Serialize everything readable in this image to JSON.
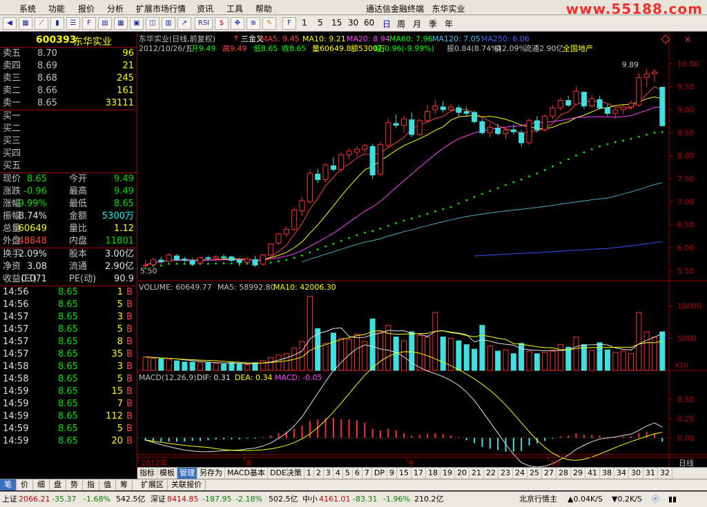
{
  "menu": [
    "系统",
    "功能",
    "报价",
    "分析",
    "扩展市场行情",
    "资讯",
    "工具",
    "帮助"
  ],
  "app_title": "通达信金融终端",
  "stock_title": "东华实业",
  "watermark": "www.55188.com",
  "toolbar": {
    "rsi": "RSI",
    "periods": [
      "1",
      "5",
      "15",
      "30",
      "60",
      "日",
      "周",
      "月",
      "季",
      "年"
    ]
  },
  "quote": {
    "code": "600393",
    "name": "东华实业",
    "asks": [
      [
        "卖五",
        "8.70",
        "96"
      ],
      [
        "卖四",
        "8.69",
        "21"
      ],
      [
        "卖三",
        "8.68",
        "245"
      ],
      [
        "卖二",
        "8.66",
        "161"
      ],
      [
        "卖一",
        "8.65",
        "33111"
      ]
    ],
    "bids": [
      "买一",
      "买二",
      "买三",
      "买四",
      "买五"
    ],
    "stats": [
      [
        "现价",
        "8.65",
        "今开",
        "9.49"
      ],
      [
        "涨跌",
        "-0.96",
        "最高",
        "9.49"
      ],
      [
        "涨幅",
        "-9.99%",
        "最低",
        "8.65"
      ],
      [
        "振幅",
        "8.74%",
        "金额",
        "5300万"
      ],
      [
        "总量",
        "60649",
        "量比",
        "1.12"
      ],
      [
        "外盘",
        "48848",
        "内盘",
        "11801"
      ]
    ],
    "stats2": [
      [
        "换手",
        "2.09%",
        "股本",
        "3.00亿"
      ],
      [
        "净资",
        "3.08",
        "流通",
        "2.90亿"
      ],
      [
        "收益(三)",
        "0.071",
        "PE(动)",
        "90.9"
      ]
    ]
  },
  "ticks": [
    [
      "14:56",
      "8.65",
      "1",
      "B"
    ],
    [
      "14:56",
      "8.65",
      "5",
      "B"
    ],
    [
      "14:57",
      "8.65",
      "3",
      "B"
    ],
    [
      "14:57",
      "8.65",
      "5",
      "B"
    ],
    [
      "14:57",
      "8.65",
      "8",
      "B"
    ],
    [
      "14:57",
      "8.65",
      "35",
      "B"
    ],
    [
      "14:58",
      "8.65",
      "3",
      "B"
    ],
    [
      "14:58",
      "8.65",
      "5",
      "B"
    ],
    [
      "14:59",
      "8.65",
      "15",
      "B"
    ],
    [
      "14:59",
      "8.65",
      "7",
      "B"
    ],
    [
      "14:59",
      "8.65",
      "112",
      "B"
    ],
    [
      "14:59",
      "8.65",
      "5",
      "B"
    ],
    [
      "14:59",
      "8.65",
      "20",
      "B"
    ]
  ],
  "left_tabs": [
    "笔",
    "价",
    "细",
    "盘",
    "势",
    "指",
    "值",
    "筹"
  ],
  "chart": {
    "header1": {
      "title": "东华实业(日线,前复权)",
      "signal": "三金叉",
      "ma5": "MA5: 9.45",
      "ma10": "MA10: 9.21",
      "ma20": "MA20: 8.94",
      "ma60": "MA60: 7.96",
      "ma120": "MA120: 7.05",
      "ma250": "MA250: 6.06"
    },
    "header2": {
      "date": "2012/10/26/五",
      "open": "开9.49",
      "high": "高9.49",
      "low": "低8.65",
      "close": "收8.65",
      "vol": "量60649.8",
      "amt": "额5300万",
      "chg": "幅-0.96(-9.99%)",
      "amp": "振0.84(8.74%)",
      "turn": "换2.09%",
      "float": "流通2.90亿",
      "sector": "全国地产"
    },
    "high_label": "9.89",
    "low_label": "5.50",
    "price_ticks": [
      "10.00",
      "9.50",
      "9.00",
      "8.50",
      "8.00",
      "7.50",
      "7.00",
      "6.50",
      "6.00",
      "5.50"
    ],
    "vol_header": {
      "title": "VOLUME: 60649.77",
      "ma5": "MA5: 58992.80",
      "ma10": "MA10: 42006.30"
    },
    "vol_ticks": [
      "10000",
      "5000"
    ],
    "vol_unit": "X10",
    "macd_header": {
      "title": "MACD(12,26,9)",
      "dif": "DIF: 0.31",
      "dea": "DEA: 0.34",
      "macd": "MACD: -0.05"
    },
    "macd_ticks": [
      "0.50",
      "0.25",
      "0.00"
    ],
    "date_labels": [
      "2012年",
      "8",
      "9",
      "10"
    ],
    "period_label": "日线"
  },
  "bottom_tabs": [
    "指标",
    "模板",
    "管理",
    "另存为",
    "MACD基本",
    "DDE决策",
    "1",
    "2",
    "3",
    "4",
    "5",
    "6",
    "7",
    "DP",
    "9",
    "15",
    "17",
    "18",
    "19",
    "20",
    "21",
    "22",
    "23",
    "24",
    "25",
    "27",
    "28",
    "29",
    "41",
    "38",
    "34",
    "30",
    "31",
    "32"
  ],
  "ext_tabs": [
    "扩展区",
    "关联报价"
  ],
  "status": {
    "sh_label": "上证",
    "sh_val": "2066.21",
    "sh_chg": "-35.37",
    "sh_pct": "-1.68%",
    "sh_amt": "542.5亿",
    "sz_label": "深证",
    "sz_val": "8414.85",
    "sz_chg": "-187.95",
    "sz_pct": "-2.18%",
    "sz_amt": "502.5亿",
    "zx_label": "中小",
    "zx_val": "4161.01",
    "zx_chg": "-83.31",
    "zx_pct": "-1.96%",
    "zx_amt": "210.2亿",
    "server": "北京行情主",
    "up": "0.04K/S",
    "down": "0.2K/S"
  },
  "chart_data": {
    "type": "candlestick",
    "title": "东华实业(日线,前复权)",
    "price_range": [
      5.4,
      10.2
    ],
    "candles": [
      [
        5.6,
        5.72,
        5.55,
        5.62
      ],
      [
        5.63,
        5.78,
        5.6,
        5.74
      ],
      [
        5.73,
        5.8,
        5.66,
        5.7
      ],
      [
        5.7,
        5.88,
        5.68,
        5.84
      ],
      [
        5.82,
        5.86,
        5.7,
        5.74
      ],
      [
        5.75,
        5.8,
        5.68,
        5.72
      ],
      [
        5.72,
        5.78,
        5.6,
        5.64
      ],
      [
        5.66,
        5.8,
        5.62,
        5.78
      ],
      [
        5.78,
        5.82,
        5.72,
        5.76
      ],
      [
        5.76,
        5.84,
        5.7,
        5.8
      ],
      [
        5.8,
        5.86,
        5.74,
        5.78
      ],
      [
        5.8,
        5.82,
        5.7,
        5.72
      ],
      [
        5.72,
        5.78,
        5.6,
        5.68
      ],
      [
        5.68,
        5.8,
        5.62,
        5.76
      ],
      [
        5.74,
        5.82,
        5.58,
        5.62
      ],
      [
        5.64,
        5.86,
        5.6,
        5.84
      ],
      [
        5.84,
        6.1,
        5.82,
        6.08
      ],
      [
        6.1,
        6.32,
        6.06,
        6.3
      ],
      [
        6.3,
        6.46,
        6.24,
        6.4
      ],
      [
        6.4,
        6.88,
        6.36,
        6.82
      ],
      [
        6.8,
        7.1,
        6.7,
        7.02
      ],
      [
        7.0,
        7.7,
        6.96,
        7.62
      ],
      [
        7.6,
        7.72,
        7.4,
        7.48
      ],
      [
        7.48,
        7.84,
        7.42,
        7.8
      ],
      [
        7.78,
        7.96,
        7.66,
        7.7
      ],
      [
        7.7,
        8.08,
        7.64,
        8.02
      ],
      [
        8.02,
        8.16,
        7.92,
        8.1
      ],
      [
        8.08,
        8.2,
        7.98,
        8.14
      ],
      [
        8.14,
        8.26,
        8.06,
        8.22
      ],
      [
        8.2,
        8.26,
        7.5,
        7.58
      ],
      [
        7.6,
        8.3,
        7.56,
        8.24
      ],
      [
        8.22,
        8.8,
        8.16,
        8.72
      ],
      [
        8.7,
        8.9,
        8.6,
        8.66
      ],
      [
        8.66,
        8.86,
        8.5,
        8.8
      ],
      [
        8.78,
        8.94,
        8.4,
        8.46
      ],
      [
        8.46,
        8.8,
        8.42,
        8.76
      ],
      [
        8.76,
        9.1,
        8.72,
        8.96
      ],
      [
        9.0,
        9.2,
        8.9,
        9.08
      ],
      [
        9.06,
        9.18,
        8.94,
        9.0
      ],
      [
        9.0,
        9.12,
        8.96,
        9.06
      ],
      [
        9.04,
        9.1,
        8.86,
        8.94
      ],
      [
        8.96,
        9.06,
        8.84,
        8.92
      ],
      [
        8.94,
        8.98,
        8.7,
        8.74
      ],
      [
        8.74,
        8.8,
        8.46,
        8.5
      ],
      [
        8.5,
        8.7,
        8.4,
        8.62
      ],
      [
        8.6,
        8.7,
        8.44,
        8.48
      ],
      [
        8.48,
        8.62,
        8.36,
        8.56
      ],
      [
        8.56,
        8.68,
        8.46,
        8.52
      ],
      [
        8.5,
        8.56,
        8.2,
        8.28
      ],
      [
        8.28,
        8.8,
        8.24,
        8.76
      ],
      [
        8.76,
        8.86,
        8.5,
        8.56
      ],
      [
        8.56,
        8.9,
        8.52,
        8.86
      ],
      [
        8.86,
        9.1,
        8.8,
        9.04
      ],
      [
        9.04,
        9.26,
        8.98,
        9.2
      ],
      [
        9.2,
        9.3,
        9.06,
        9.1
      ],
      [
        9.12,
        9.5,
        9.1,
        9.4
      ],
      [
        9.38,
        9.4,
        9.02,
        9.08
      ],
      [
        9.08,
        9.32,
        9.04,
        9.24
      ],
      [
        9.22,
        9.3,
        9.0,
        9.04
      ],
      [
        9.04,
        9.12,
        8.86,
        8.92
      ],
      [
        8.92,
        9.06,
        8.8,
        9.0
      ],
      [
        9.0,
        9.1,
        8.9,
        9.06
      ],
      [
        9.06,
        9.2,
        9.0,
        9.14
      ],
      [
        9.1,
        9.8,
        9.06,
        9.7
      ],
      [
        9.7,
        9.89,
        9.5,
        9.78
      ],
      [
        9.78,
        9.89,
        9.6,
        9.82
      ],
      [
        9.49,
        9.49,
        8.65,
        8.65
      ]
    ],
    "volume_range": [
      0,
      12000
    ],
    "volume": [
      2100,
      1900,
      1800,
      1700,
      1500,
      1300,
      1300,
      1200,
      1200,
      1100,
      1000,
      1200,
      1000,
      900,
      1200,
      1500,
      2000,
      2400,
      2600,
      3500,
      4500,
      11500,
      6500,
      4200,
      5800,
      5000,
      4800,
      5600,
      4500,
      8000,
      6000,
      7000,
      5200,
      4600,
      6000,
      5400,
      5200,
      9000,
      5200,
      5000,
      4600,
      4000,
      3300,
      7000,
      3800,
      3000,
      3200,
      2600,
      4200,
      3000,
      2600,
      2800,
      3000,
      4000,
      3600,
      5200,
      4000,
      3100,
      4300,
      3200,
      2800,
      3000,
      2600,
      9000,
      6000,
      5200,
      6000
    ],
    "macd_range": [
      -0.2,
      0.7
    ],
    "macd": [
      -0.04,
      -0.05,
      -0.05,
      -0.05,
      -0.05,
      -0.05,
      -0.04,
      -0.04,
      -0.03,
      -0.02,
      -0.02,
      -0.02,
      -0.02,
      -0.01,
      -0.01,
      0.01,
      0.03,
      0.06,
      0.08,
      0.12,
      0.16,
      0.22,
      0.24,
      0.26,
      0.26,
      0.24,
      0.24,
      0.23,
      0.2,
      0.12,
      0.1,
      0.12,
      0.1,
      0.06,
      0.03,
      0.04,
      0.05,
      0.06,
      0.05,
      0.03,
      0.01,
      -0.03,
      -0.07,
      -0.12,
      -0.14,
      -0.16,
      -0.18,
      -0.18,
      -0.17,
      -0.1,
      -0.07,
      -0.04,
      -0.01,
      0.02,
      0.03,
      0.06,
      0.04,
      0.04,
      0.03,
      0.01,
      0.01,
      0.02,
      0.02,
      0.06,
      0.08,
      0.06,
      -0.05
    ]
  }
}
